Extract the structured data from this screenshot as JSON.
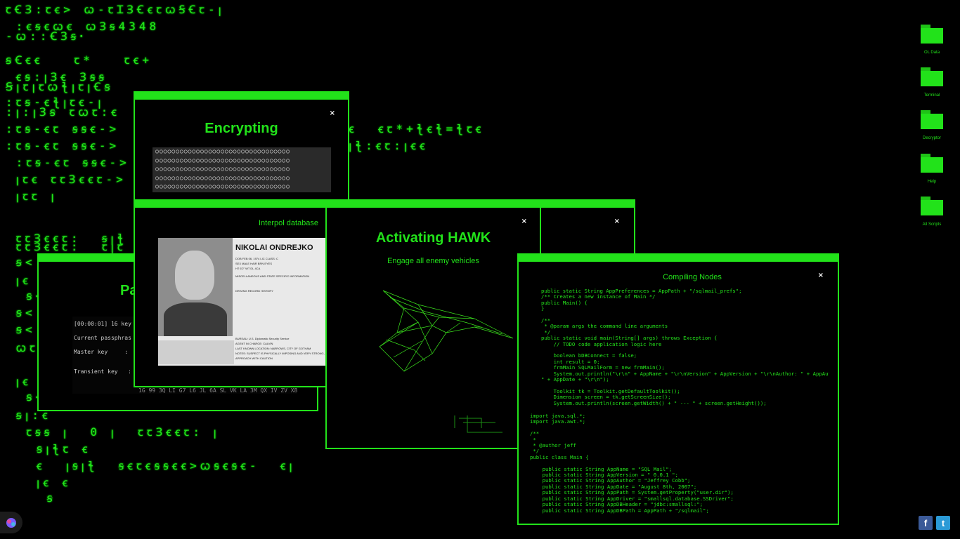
{
  "background": {
    "glyph_lines": [
      "ꞇꞒꞫ:ꞇꞓ> ꞷ-ꞇꞮꞫꞒꞓꞇꞷꞨꞒꞇ-ꞁ",
      " :ꞓꞩꞓꞷꞓ ꞷꞫꞩ4348",
      "-ꞷ::ꞒꞫꞩꞏ",
      "ꞩꞒꞓꞓ   ꞇ*   ꞇꞓ+",
      " ꞓꞩ:ꞁꞫꞓ Ɜꞩꞩ",
      "ꞨꞁꞇꞁꞇꞷꞎꞁꞇꞁꞒꞩ",
      ":ꞇꞩ-ꞓꞎꞁꞇꞓ-ꞁ",
      ":ꞁ:ꞁꞫꞩ ꞇꞷꞇ:ꞓ",
      ":ꞇꞩ-ꞓꞇ ꞩꞩꞓ->",
      ":ꞇꞩ-ꞓꞇ ꞩꞩꞓ->",
      " :ꞇꞩ-ꞓꞇ ꞩꞩꞓ->",
      " ꞁꞇꞓ ꞇꞇꞫꞓꞓꞇ->",
      " ꞁꞇꞇ ꞁ",
      " ꞇꞇꞫꞓꞓꞇ:  ꞩꞁꞎ",
      " ꞇꞇꞫꞓꞓꞇ:  ꞇꞁꞇ",
      " ꞩ<",
      " ꞁꞓ",
      "  ꞩ<",
      " ꞩ<",
      " ꞩ<",
      " ꞷꞇ",
      " ꞁꞓ",
      "  ꞩ<",
      " ꞩꞁ:ꞓ",
      "  ꞇꞩꞩ ꞁ  0 ꞁ  ꞇꞇꞫꞓꞓꞇ: ꞁ",
      "   ꞩꞁꞎꞇ ꞓ",
      "   ꞓ  ꞁꞩꞁꞎ  ꞩꞓꞇꞓꞩꞩꞓꞓ>ꞷꞩꞓꞩꞓ-  ꞓꞁ",
      "   ꞁꞓ ꞓ",
      "    ꞩ"
    ],
    "right_glyphs_1": "ꞓ  ꞓꞇ*+ꞎꞓꞎ=ꞎꞇꞓ",
    "right_glyphs_2": "ꞁꞎ:ꞓꞇ:ꞁꞓꞓ"
  },
  "desktop_icons": [
    {
      "label": "OL Data",
      "icon": "folder-icon"
    },
    {
      "label": "Terminal",
      "icon": "folder-icon"
    },
    {
      "label": "Decryptor",
      "icon": "folder-icon"
    },
    {
      "label": "Help",
      "icon": "folder-icon"
    },
    {
      "label": "All Scripts",
      "icon": "folder-icon"
    }
  ],
  "encrypting_window": {
    "title": "Encrypting",
    "close": "×",
    "dots": "○○○○○○○○○○○○○○○○○○○○○○○○○○○○○○○○○\n○○○○○○○○○○○○○○○○○○○○○○○○○○○○○○○○○\n○○○○○○○○○○○○○○○○○○○○○○○○○○○○○○○○○\n○○○○○○○○○○○○○○○○○○○○○○○○○○○○○○○○○\n○○○○○○○○○○○○○○○○○○○○○○○○○○○○○○○○○"
  },
  "passphrase_window": {
    "title": "Pa",
    "log_line": "[00:00:01] 16 key",
    "current": "Current passphras",
    "master_key": "Master key     :",
    "transient_key": "Transient key   :",
    "key_string": "1G 99 3Q LI G7 L6 JL 6A SL VK LA 3M QX IV ZV X8"
  },
  "interpol_window": {
    "title": "Interpol database",
    "close": "×",
    "name": "NIKOLAI ONDREJKO",
    "fields": [
      "DOB  FEB 06, 1974   LIC CLASS: C",
      "SEX  MALE      HAIR  BRN   EYES",
      "HT   6'2\"      WT          DL  4CA"
    ],
    "section1": "MISCELLANEOUS AND STATE SPECIFIC INFORMATION",
    "section2": "DRIVING RECORD HISTORY",
    "bureau": "BUREAU: U.S. Diplomatic Security Service",
    "agent": "AGENT IN CHARGE: CALVIN",
    "last_known": "LAST KNOWN LOCATION: NARROWS, CITY OF GOTHAM",
    "notes": "NOTES: SUSPECT IS PHYSICALLY IMPOSING AND VERY STRONG, APPROACH WITH CAUTION"
  },
  "hawk_window": {
    "title": "Activating HAWK",
    "subtitle": "Engage all enemy vehicles",
    "close": "×"
  },
  "compiling_window": {
    "title": "Compiling Nodes",
    "close": "×",
    "code": "public static String AppPreferences = AppPath + \"/sqlmail_prefs\";\n/** Creates a new instance of Main */\npublic Main() {\n}\n\n/**\n * @param args the command line arguments\n */\npublic static void main(String[] args) throws Exception {\n    // TODO code application logic here\n\n    boolean bDBConnect = false;\n    int result = 0;\n    frmMain SQLMailForm = new frmMain();\n    System.out.println(\"\\r\\n\" + AppName + \"\\r\\nVersion\" + AppVersion + \"\\r\\nAuthor: \" + AppAuthor + \"\n\" + AppDate + \"\\r\\n\");\n\n    Toolkit tk = Toolkit.getDefaultToolkit();\n    Dimension screen = tk.getScreenSize();\n    System.out.println(screen.getWidth() + \" --- \" + screen.getHeight());",
    "code2": "import java.sql.*;\nimport java.awt.*;\n\n/**\n *\n * @author jeff\n */\npublic class Main {\n\n    public static String AppName = \"SQL Mail\";\n    public static String AppVersion = \" 0.0.1 \";\n    public static String AppAuthor = \"Jeffrey Cobb\";\n    public static String AppDate = \"August 8th, 2007\";\n    public static String AppPath = System.getProperty(\"user.dir\");\n    public static String AppDriver = \"smallsql.database.SSDriver\";\n    public static String AppDBHeader = \"jdbc:smallsql:\";\n    public static String AppDBPath = AppPath + \"/sqlmail\";"
  },
  "social": {
    "facebook": "f",
    "twitter": "t"
  }
}
